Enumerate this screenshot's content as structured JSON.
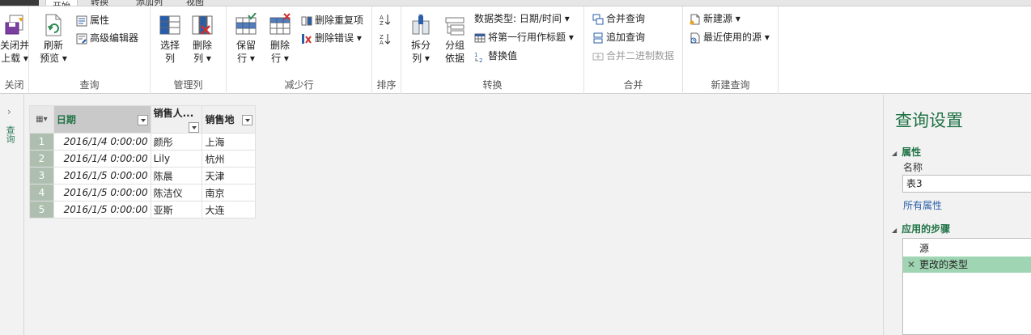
{
  "tabs": [
    {
      "label": "开始",
      "active": true
    },
    {
      "label": "转换"
    },
    {
      "label": "添加列"
    },
    {
      "label": "视图"
    }
  ],
  "ribbon": {
    "close": {
      "close_load": "关闭并",
      "close_load2": "上载",
      "group_label": "关闭"
    },
    "query": {
      "refresh": "刷新",
      "preview": "预览",
      "properties": "属性",
      "advanced_editor": "高级编辑器",
      "group_label": "查询"
    },
    "manage_columns": {
      "choose_1": "选择",
      "choose_2": "列",
      "remove_1": "删除",
      "remove_2": "列",
      "group_label": "管理列"
    },
    "reduce_rows": {
      "keep_1": "保留",
      "keep_2": "行",
      "remove_1": "删除",
      "remove_2": "行",
      "remove_duplicates": "删除重复项",
      "remove_errors": "删除错误",
      "group_label": "减少行"
    },
    "sort": {
      "group_label": "排序"
    },
    "transform": {
      "split_1": "拆分",
      "split_2": "列",
      "group_1": "分组",
      "group_2": "依据",
      "data_type": "数据类型: 日期/时间",
      "first_row_header": "将第一行用作标题",
      "replace_values": "替换值",
      "group_label": "转换"
    },
    "combine": {
      "merge_queries": "合并查询",
      "append_queries": "追加查询",
      "combine_binaries": "合并二进制数据",
      "group_label": "合并"
    },
    "new_query": {
      "new_source": "新建源",
      "recent_sources": "最近使用的源",
      "group_label": "新建查询"
    }
  },
  "leftnav": {
    "label": "查询"
  },
  "grid": {
    "columns": [
      "日期",
      "销售人...",
      "销售地"
    ],
    "rows": [
      {
        "n": "1",
        "date": "2016/1/4 0:00:00",
        "person": "颜彤",
        "place": "上海"
      },
      {
        "n": "2",
        "date": "2016/1/4 0:00:00",
        "person": "Lily",
        "place": "杭州"
      },
      {
        "n": "3",
        "date": "2016/1/5 0:00:00",
        "person": "陈晨",
        "place": "天津"
      },
      {
        "n": "4",
        "date": "2016/1/5 0:00:00",
        "person": "陈洁仪",
        "place": "南京"
      },
      {
        "n": "5",
        "date": "2016/1/5 0:00:00",
        "person": "亚斯",
        "place": "大连"
      }
    ]
  },
  "query_settings": {
    "title": "查询设置",
    "properties_header": "属性",
    "name_label": "名称",
    "name_value": "表3",
    "all_properties": "所有属性",
    "applied_steps_header": "应用的步骤",
    "steps": [
      "源",
      "更改的类型"
    ]
  },
  "colors": {
    "accent": "#217346",
    "selected_step": "#9fd5b2"
  }
}
